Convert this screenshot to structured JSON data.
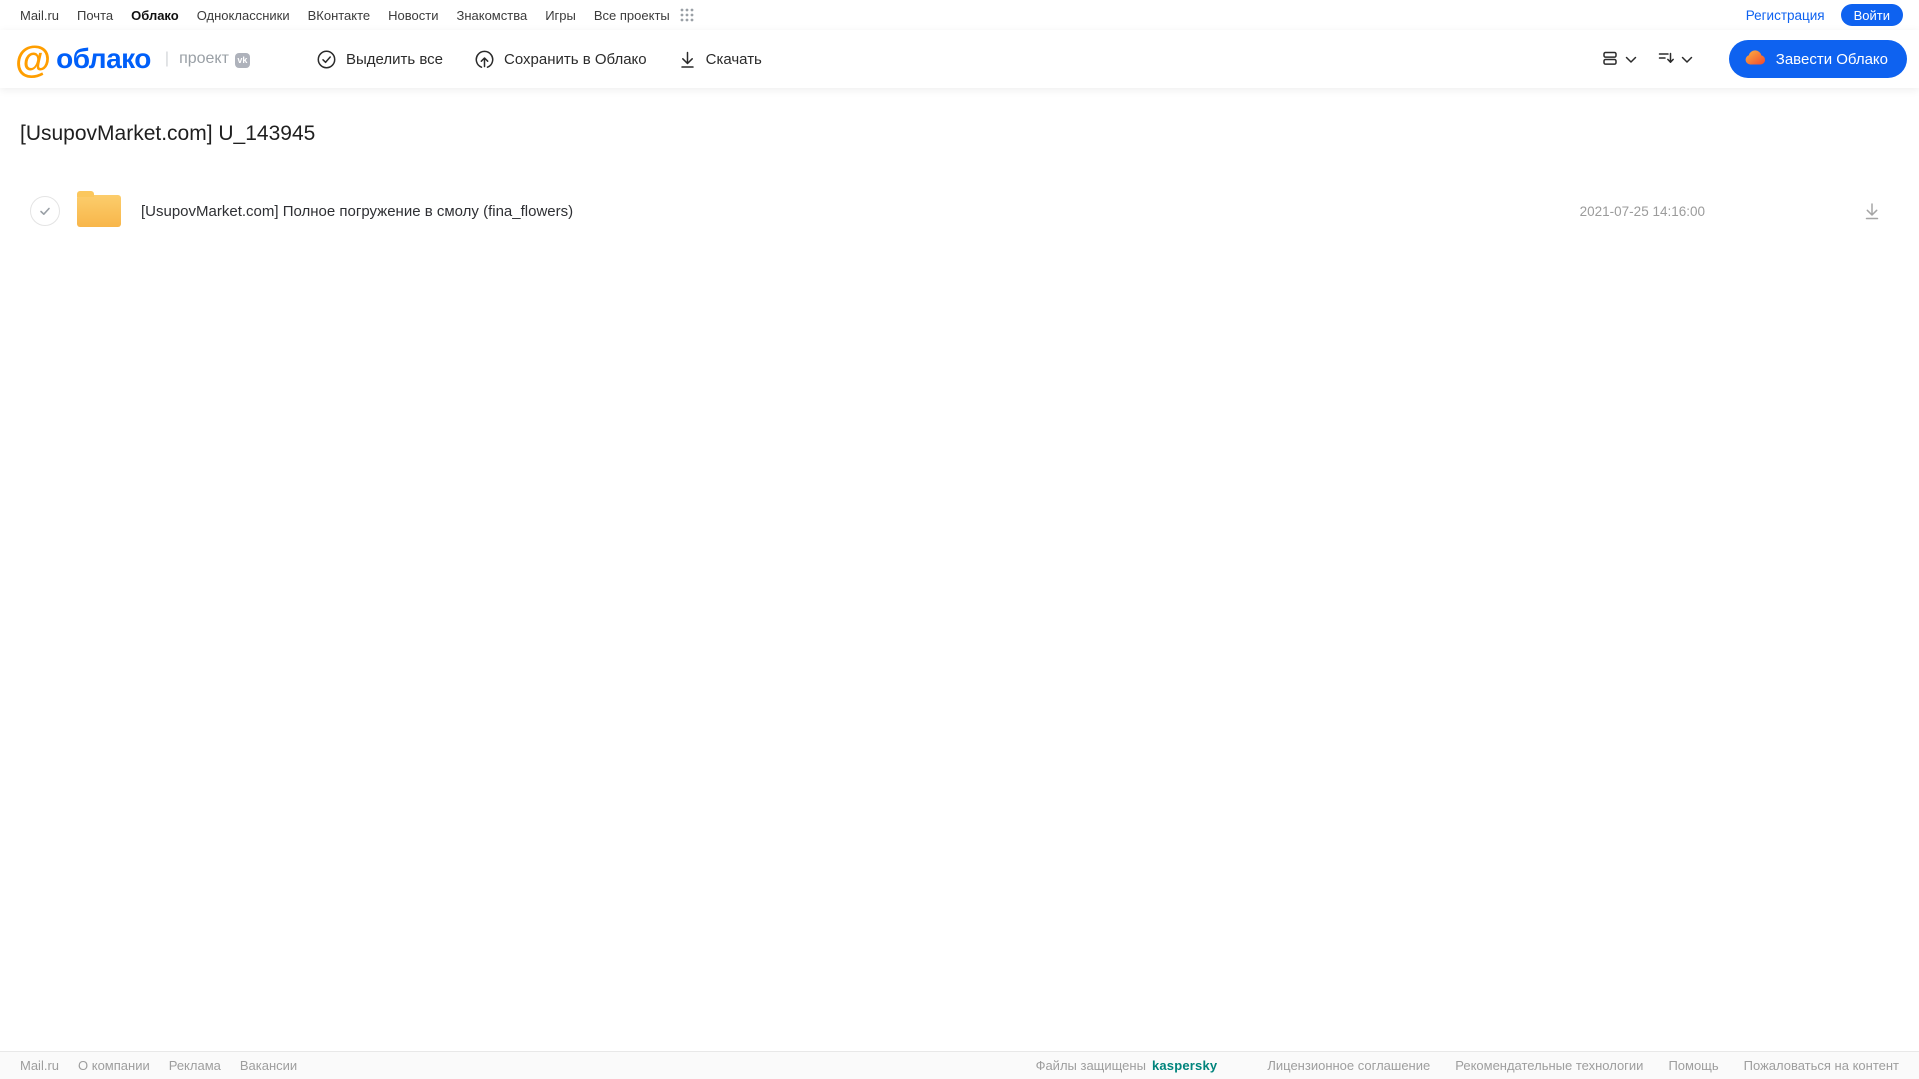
{
  "colors": {
    "accent-blue": "#0E62F0",
    "logo-blue": "#005FF9",
    "logo-orange": "#FF9E00",
    "folder-yellow": "#F9BC4F",
    "kaspersky-teal": "#00847C"
  },
  "topnav": {
    "links": [
      "Mail.ru",
      "Почта",
      "Облако",
      "Одноклассники",
      "ВКонтакте",
      "Новости",
      "Знакомства",
      "Игры",
      "Все проекты"
    ],
    "active_link": "Облако",
    "registration_label": "Регистрация",
    "login_label": "Войти"
  },
  "header": {
    "logo_at": "@",
    "logo_text": "облако",
    "project_label": "проект",
    "vk_badge": "vk",
    "toolbar": {
      "select_all": "Выделить все",
      "save_to_cloud": "Сохранить в Облако",
      "download": "Скачать"
    },
    "get_cloud_label": "Завести Облако"
  },
  "page": {
    "title": "[UsupovMarket.com] U_143945"
  },
  "files": [
    {
      "type": "folder",
      "name": "[UsupovMarket.com] Полное погружение в смолу (fina_flowers)",
      "date": "2021-07-25 14:16:00"
    }
  ],
  "footer": {
    "left_links": [
      "Mail.ru",
      "О компании",
      "Реклама",
      "Вакансии"
    ],
    "protected_label": "Файлы защищены",
    "kaspersky_label": "kaspersky",
    "right_links": [
      "Лицензионное соглашение",
      "Рекомендательные технологии",
      "Помощь",
      "Пожаловаться на контент"
    ]
  }
}
